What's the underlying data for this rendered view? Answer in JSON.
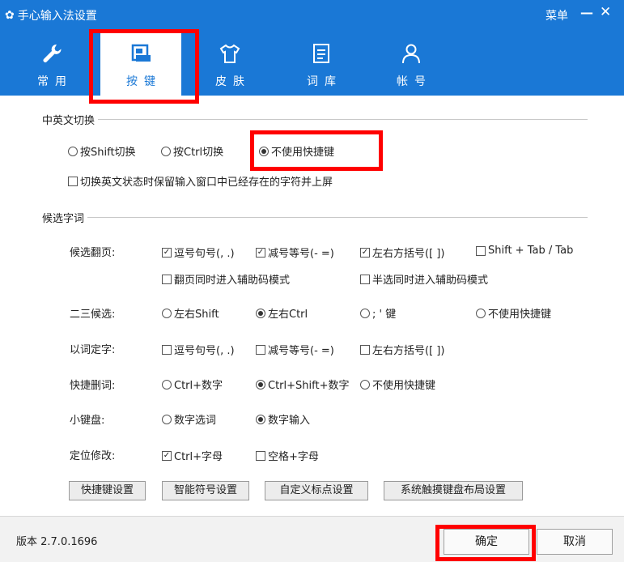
{
  "window": {
    "title": "手心输入法设置",
    "menu_label": "菜单",
    "min_glyph": "—",
    "close_glyph": "✕"
  },
  "tabs": [
    {
      "label": "常用",
      "icon": "wrench-icon",
      "active": false
    },
    {
      "label": "按键",
      "icon": "keyboard-icon",
      "active": true
    },
    {
      "label": "皮肤",
      "icon": "shirt-icon",
      "active": false
    },
    {
      "label": "词库",
      "icon": "document-icon",
      "active": false
    },
    {
      "label": "帐号",
      "icon": "user-icon",
      "active": false
    }
  ],
  "switch_section": {
    "title": "中英文切换",
    "options": [
      "按Shift切换",
      "按Ctrl切换",
      "不使用快捷键"
    ],
    "selected": "不使用快捷键",
    "keep_checkbox": {
      "label": "切换英文状态时保留输入窗口中已经存在的字符并上屏",
      "checked": false
    }
  },
  "candidate_section": {
    "title": "候选字词",
    "paging": {
      "label": "候选翻页:",
      "checks": [
        {
          "label": "逗号句号(, .)",
          "checked": true
        },
        {
          "label": "减号等号(- =)",
          "checked": true
        },
        {
          "label": "左右方括号([ ])",
          "checked": true
        },
        {
          "label": "Shift + Tab / Tab",
          "checked": false
        }
      ],
      "checks2": [
        {
          "label": "翻页同时进入辅助码模式",
          "checked": false
        },
        {
          "label": "半选同时进入辅助码模式",
          "checked": false
        }
      ]
    },
    "second_third": {
      "label": "二三候选:",
      "options": [
        "左右Shift",
        "左右Ctrl",
        "; ' 键",
        "不使用快捷键"
      ],
      "selected": "左右Ctrl"
    },
    "word_char": {
      "label": "以词定字:",
      "checks": [
        {
          "label": "逗号句号(, .)",
          "checked": false
        },
        {
          "label": "减号等号(- =)",
          "checked": false
        },
        {
          "label": "左右方括号([ ])",
          "checked": false
        }
      ]
    },
    "delete_word": {
      "label": "快捷删词:",
      "options": [
        "Ctrl+数字",
        "Ctrl+Shift+数字",
        "不使用快捷键"
      ],
      "selected": "Ctrl+Shift+数字"
    },
    "numpad": {
      "label": "小键盘:",
      "options": [
        "数字选词",
        "数字输入"
      ],
      "selected": "数字输入"
    },
    "locate": {
      "label": "定位修改:",
      "checks": [
        {
          "label": "Ctrl+字母",
          "checked": true
        },
        {
          "label": "空格+字母",
          "checked": false
        }
      ]
    }
  },
  "buttons": [
    "快捷键设置",
    "智能符号设置",
    "自定义标点设置",
    "系统触摸键盘布局设置"
  ],
  "footer": {
    "version": "版本 2.7.0.1696",
    "ok": "确定",
    "cancel": "取消"
  },
  "colors": {
    "accent": "#1a78d6",
    "highlight": "#ff0000"
  }
}
